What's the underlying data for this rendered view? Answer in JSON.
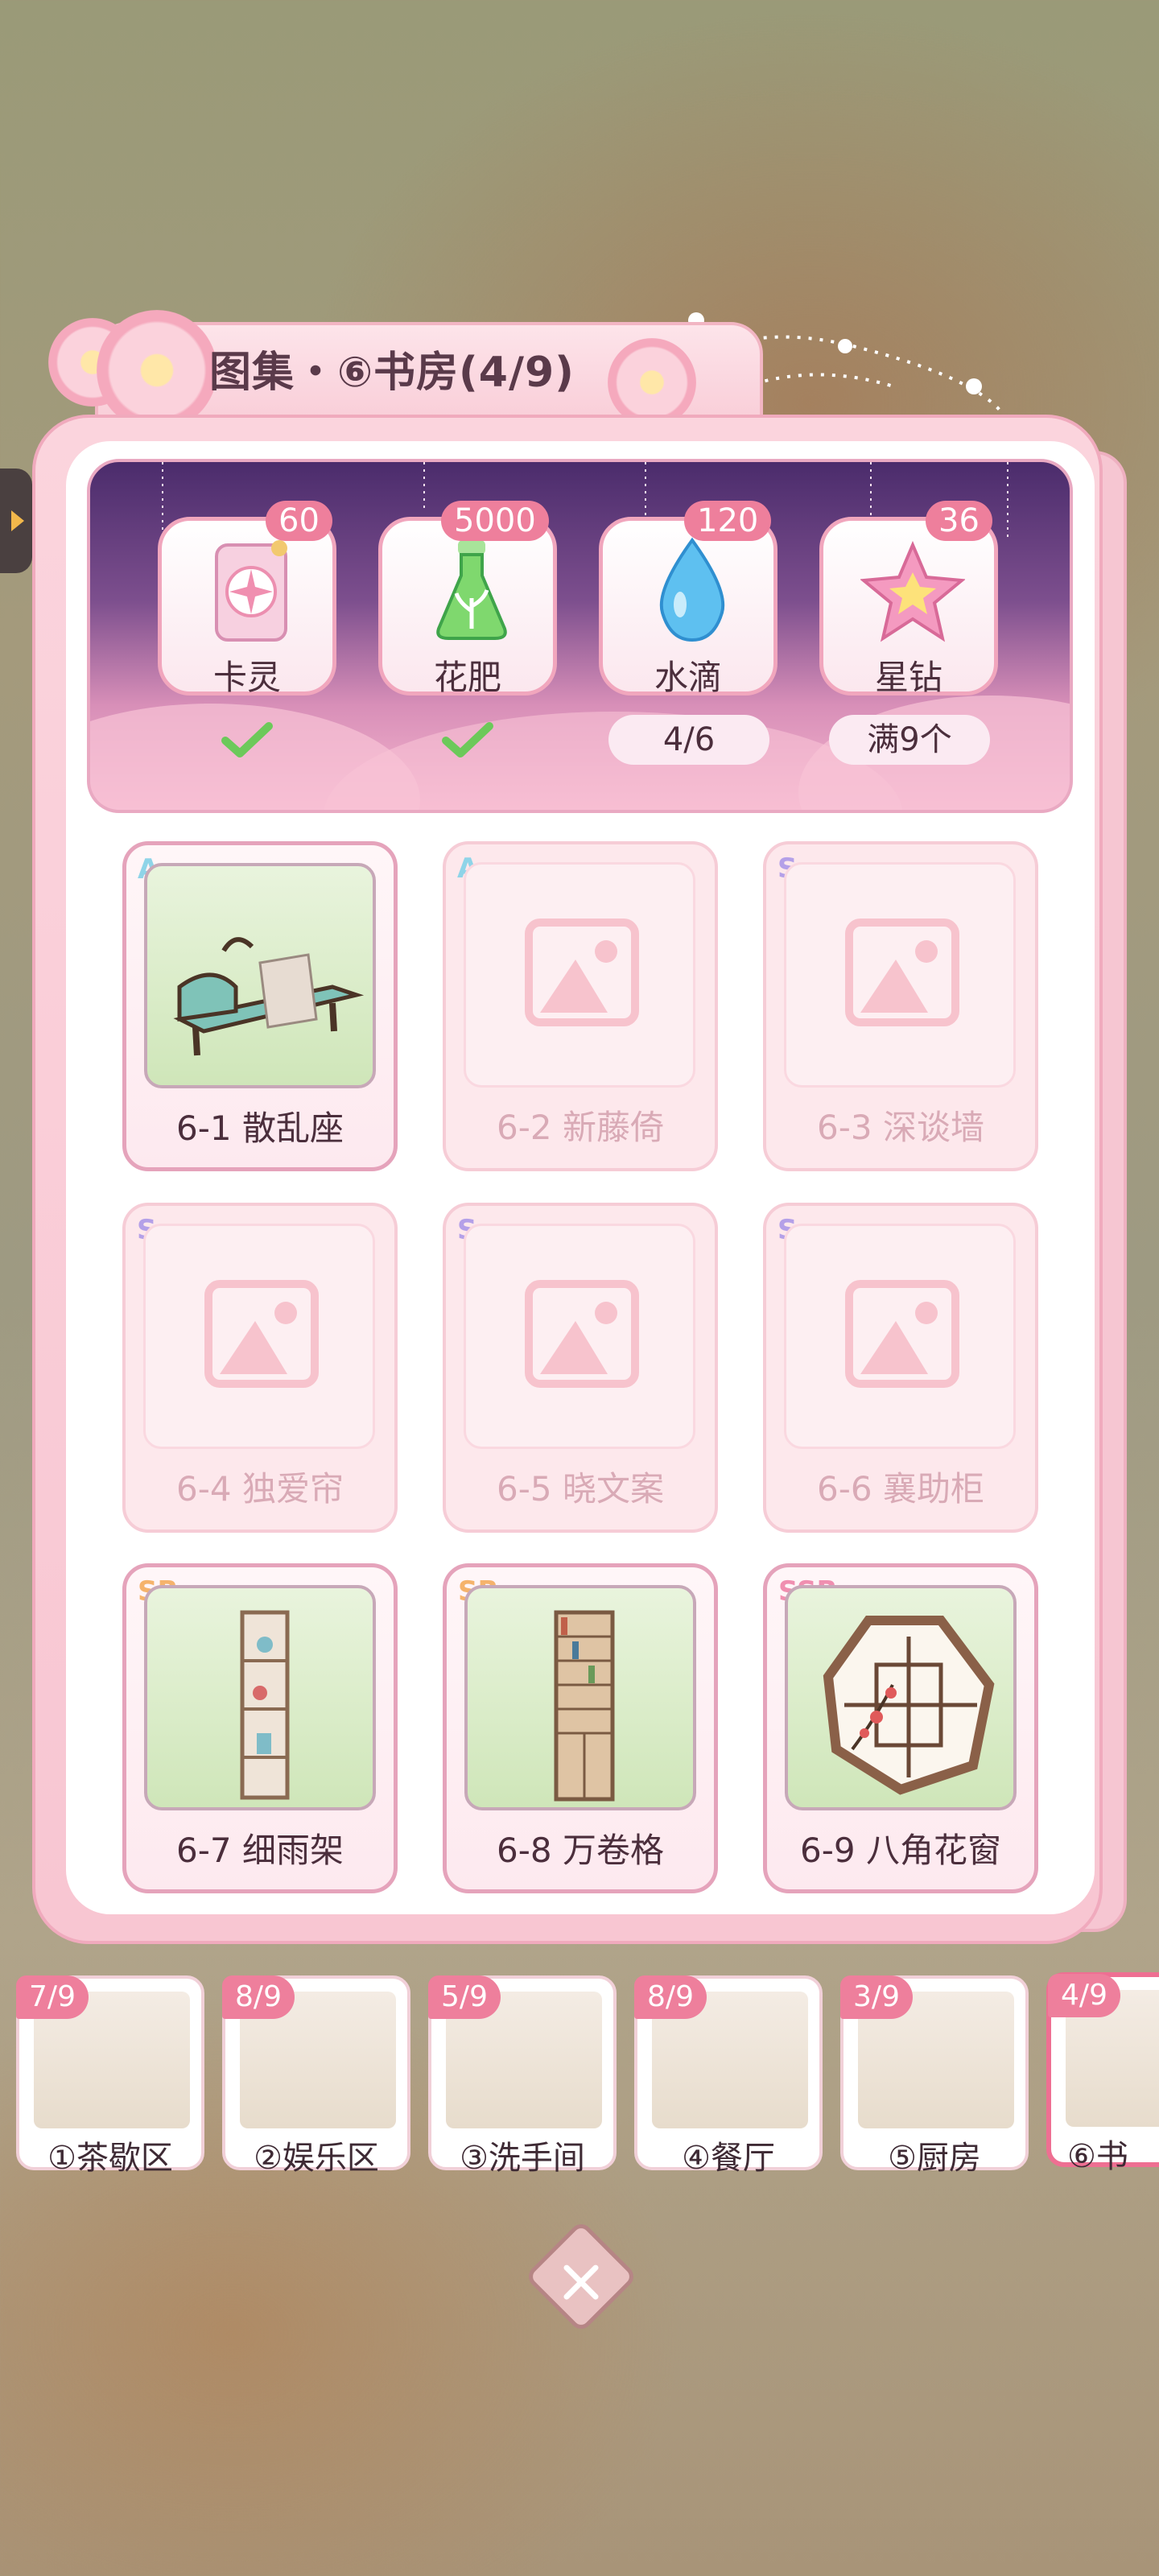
{
  "title": "图集・⑥书房(4/9)",
  "resources": [
    {
      "label": "卡灵",
      "badge": "60",
      "status_type": "check",
      "icon": "card-icon"
    },
    {
      "label": "花肥",
      "badge": "5000",
      "status_type": "check",
      "icon": "fertilizer-flask-icon"
    },
    {
      "label": "水滴",
      "badge": "120",
      "status_type": "text",
      "status": "4/6",
      "icon": "water-drop-icon"
    },
    {
      "label": "星钻",
      "badge": "36",
      "status_type": "text",
      "status": "满9个",
      "icon": "star-diamond-icon"
    }
  ],
  "items": [
    {
      "label": "6-1 散乱座",
      "rarity": "A",
      "owned": true,
      "image": "lounge-chair"
    },
    {
      "label": "6-2 新藤倚",
      "rarity": "A",
      "owned": false
    },
    {
      "label": "6-3 深谈墙",
      "rarity": "S",
      "owned": false
    },
    {
      "label": "6-4 独爱帘",
      "rarity": "S",
      "owned": false
    },
    {
      "label": "6-5 晓文案",
      "rarity": "S",
      "owned": false
    },
    {
      "label": "6-6 襄助柜",
      "rarity": "S",
      "owned": false
    },
    {
      "label": "6-7 细雨架",
      "rarity": "SR",
      "owned": true,
      "image": "narrow-shelf"
    },
    {
      "label": "6-8 万卷格",
      "rarity": "SR",
      "owned": true,
      "image": "bookcase"
    },
    {
      "label": "6-9 八角花窗",
      "rarity": "SSR",
      "owned": true,
      "image": "octagon-window"
    }
  ],
  "tabs": [
    {
      "badge": "7/9",
      "label": "①茶歇区"
    },
    {
      "badge": "8/9",
      "label": "②娱乐区"
    },
    {
      "badge": "5/9",
      "label": "③洗手间"
    },
    {
      "badge": "8/9",
      "label": "④餐厅"
    },
    {
      "badge": "3/9",
      "label": "⑤厨房"
    },
    {
      "badge": "4/9",
      "label": "⑥书",
      "active": true
    }
  ]
}
